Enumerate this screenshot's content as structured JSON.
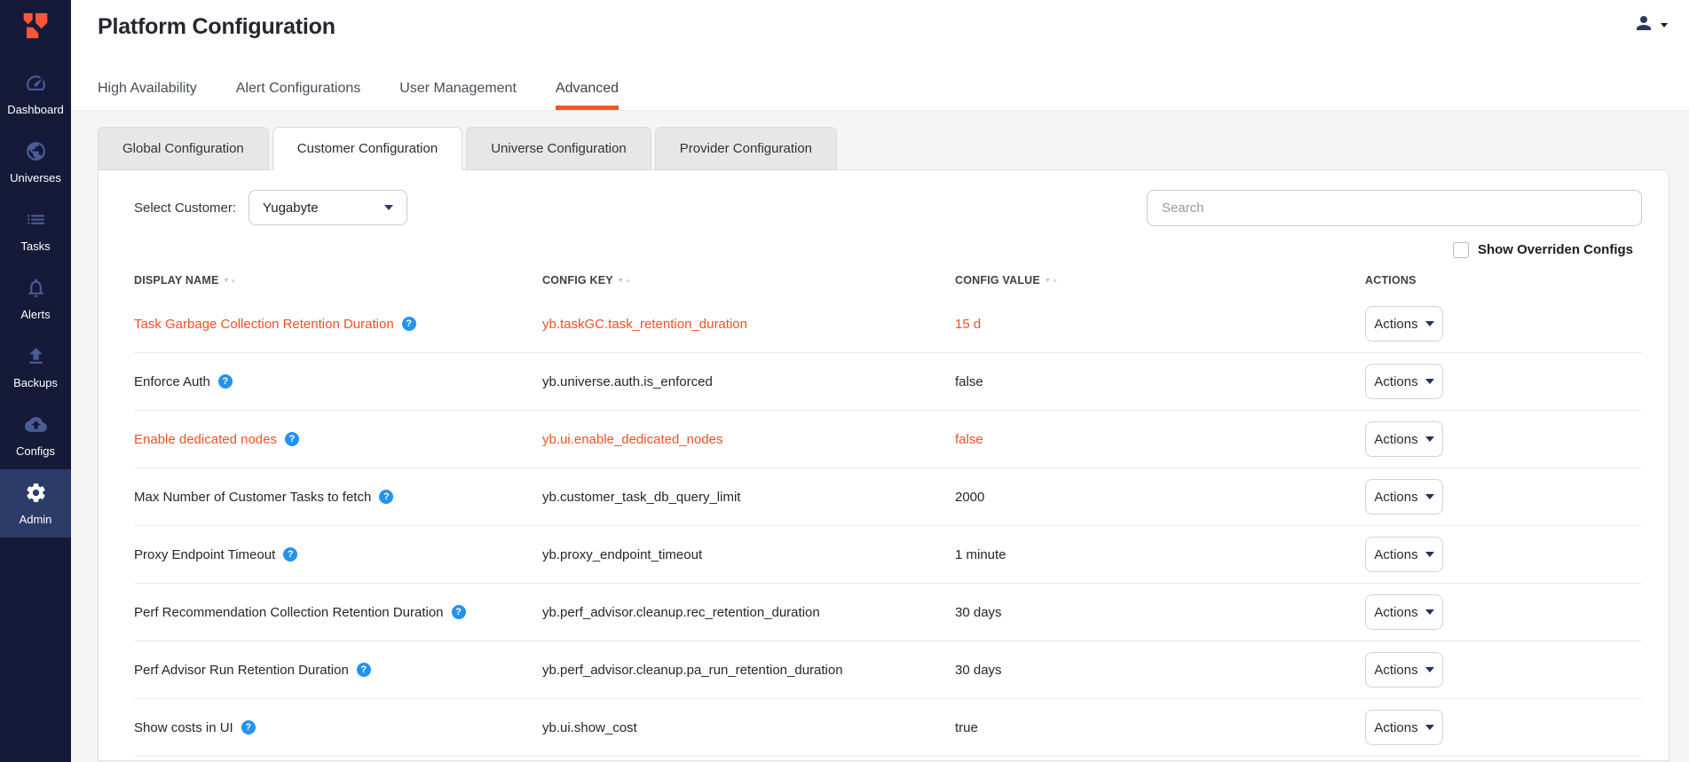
{
  "colors": {
    "accent_orange": "#ef5824",
    "overridden_red": "#ef5124",
    "help_blue": "#2492f0",
    "sidebar_bg": "#151a38",
    "sidebar_active_bg": "#2c3b68",
    "sidebar_icon": "#4d5c95"
  },
  "sidebar": {
    "logo_icon": "yugabyte-logo-icon",
    "items": [
      {
        "label": "Dashboard",
        "icon": "dashboard-icon",
        "active": false
      },
      {
        "label": "Universes",
        "icon": "globe-icon",
        "active": false
      },
      {
        "label": "Tasks",
        "icon": "list-icon",
        "active": false
      },
      {
        "label": "Alerts",
        "icon": "bell-icon",
        "active": false
      },
      {
        "label": "Backups",
        "icon": "upload-icon",
        "active": false
      },
      {
        "label": "Configs",
        "icon": "cloud-upload-icon",
        "active": false
      },
      {
        "label": "Admin",
        "icon": "gear-icon",
        "active": true
      }
    ]
  },
  "header": {
    "title": "Platform Configuration",
    "nav_tabs": [
      {
        "label": "High Availability",
        "active": false
      },
      {
        "label": "Alert Configurations",
        "active": false
      },
      {
        "label": "User Management",
        "active": false
      },
      {
        "label": "Advanced",
        "active": true
      }
    ],
    "user_menu_icon": "person-icon"
  },
  "subtabs": [
    {
      "label": "Global Configuration",
      "active": false
    },
    {
      "label": "Customer Configuration",
      "active": true
    },
    {
      "label": "Universe Configuration",
      "active": false
    },
    {
      "label": "Provider Configuration",
      "active": false
    }
  ],
  "controls": {
    "select_customer_label": "Select Customer:",
    "customer_value": "Yugabyte",
    "search_placeholder": "Search",
    "search_value": "",
    "show_overridden_label": "Show Overriden Configs",
    "show_overridden_checked": false
  },
  "table": {
    "columns": [
      {
        "label": "DISPLAY NAME",
        "sortable": true
      },
      {
        "label": "CONFIG KEY",
        "sortable": true
      },
      {
        "label": "CONFIG VALUE",
        "sortable": true
      },
      {
        "label": "ACTIONS",
        "sortable": false
      }
    ],
    "help_icon": "question-mark-icon",
    "actions_button_label": "Actions",
    "rows": [
      {
        "display_name": "Task Garbage Collection Retention Duration",
        "config_key": "yb.taskGC.task_retention_duration",
        "config_value": "15 d",
        "overridden": true
      },
      {
        "display_name": "Enforce Auth",
        "config_key": "yb.universe.auth.is_enforced",
        "config_value": "false",
        "overridden": false
      },
      {
        "display_name": "Enable dedicated nodes",
        "config_key": "yb.ui.enable_dedicated_nodes",
        "config_value": "false",
        "overridden": true
      },
      {
        "display_name": "Max Number of Customer Tasks to fetch",
        "config_key": "yb.customer_task_db_query_limit",
        "config_value": "2000",
        "overridden": false
      },
      {
        "display_name": "Proxy Endpoint Timeout",
        "config_key": "yb.proxy_endpoint_timeout",
        "config_value": "1 minute",
        "overridden": false
      },
      {
        "display_name": "Perf Recommendation Collection Retention Duration",
        "config_key": "yb.perf_advisor.cleanup.rec_retention_duration",
        "config_value": "30 days",
        "overridden": false
      },
      {
        "display_name": "Perf Advisor Run Retention Duration",
        "config_key": "yb.perf_advisor.cleanup.pa_run_retention_duration",
        "config_value": "30 days",
        "overridden": false
      },
      {
        "display_name": "Show costs in UI",
        "config_key": "yb.ui.show_cost",
        "config_value": "true",
        "overridden": false
      }
    ]
  }
}
